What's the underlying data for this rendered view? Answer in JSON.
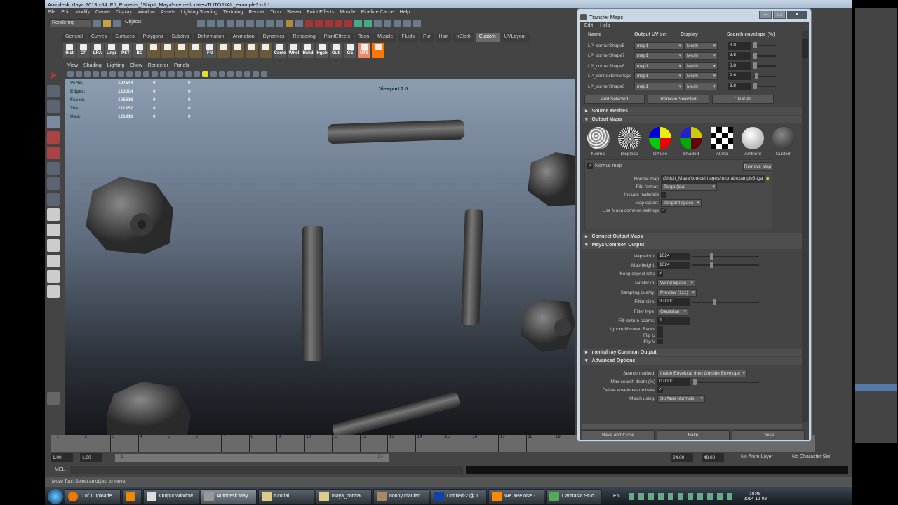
{
  "window": {
    "title": "Autodesk Maya 2013 x64: F:\\_Projects_\\ShipIt_Maya\\scenes\\crates\\TUTORIAL_example2.mb*"
  },
  "menu": [
    "File",
    "Edit",
    "Modify",
    "Create",
    "Display",
    "Window",
    "Assets",
    "Lighting/Shading",
    "Texturing",
    "Render",
    "Toon",
    "Stereo",
    "Paint Effects",
    "Muscle",
    "Pipeline Cache",
    "Help"
  ],
  "toolbar": {
    "menuset": "Rendering",
    "selection_mode": "Objects"
  },
  "shelf_tabs": [
    "General",
    "Curves",
    "Surfaces",
    "Polygons",
    "Subdivs",
    "Deformation",
    "Animation",
    "Dynamics",
    "Rendering",
    "PaintEffects",
    "Toon",
    "Muscle",
    "Fluids",
    "Fur",
    "Hair",
    "nCloth",
    "Custom",
    "UVLayout"
  ],
  "shelf_active": "Custom",
  "shelf_buttons": [
    "Hist",
    "CP",
    "LRA",
    "Ungr",
    "PST",
    "BC",
    "",
    "",
    "",
    "",
    "FN",
    "",
    "",
    "",
    "",
    "Cente",
    "Whol",
    "Hshd",
    "Hgph",
    "Outl",
    "GE",
    "UTE"
  ],
  "panel_menu": [
    "View",
    "Shading",
    "Lighting",
    "Show",
    "Renderer",
    "Panels"
  ],
  "hud": {
    "rows": [
      {
        "label": "Verts:",
        "v": [
          "107544",
          "0",
          "0"
        ]
      },
      {
        "label": "Edges:",
        "v": [
          "213004",
          "0",
          "0"
        ]
      },
      {
        "label": "Faces:",
        "v": [
          "105616",
          "0",
          "0"
        ]
      },
      {
        "label": "Tris:",
        "v": [
          "211352",
          "0",
          "0"
        ]
      },
      {
        "label": "UVs:",
        "v": [
          "121910",
          "0",
          "0"
        ]
      }
    ]
  },
  "viewport_name": "Viewport 2.0",
  "timeline": {
    "ticks": [
      "1",
      "2",
      "3",
      "4",
      "5",
      "6",
      "7",
      "8",
      "9",
      "10",
      "11",
      "12",
      "13",
      "14",
      "15",
      "16",
      "17",
      "18",
      "19"
    ]
  },
  "range": {
    "start": "1.00",
    "start2": "1.00",
    "slider_start": "1",
    "slider_end": "24",
    "end": "24.00",
    "end2": "48.00",
    "anim_layer": "No Anim Layer",
    "char_set": "No Character Set"
  },
  "mel": {
    "label": "MEL"
  },
  "helpline": "Move Tool: Select an object to move.",
  "dialog": {
    "title": "Transfer Maps",
    "menu": [
      "Edit",
      "Help"
    ],
    "columns": [
      "Name",
      "Output UV set",
      "Display",
      "Search envelope (%)"
    ],
    "meshes": [
      {
        "name": "LP_cornerShape5",
        "uv": "map1",
        "display": "Mesh",
        "env": "3.8"
      },
      {
        "name": "LP_cornerShape7",
        "uv": "map1",
        "display": "Mesh",
        "env": "3.8"
      },
      {
        "name": "LP_cornerShape8",
        "uv": "map1",
        "display": "Mesh",
        "env": "3.8"
      },
      {
        "name": "LP_connector8Shape",
        "uv": "map1",
        "display": "Mesh",
        "env": "9.6"
      },
      {
        "name": "LP_cornerShape6",
        "uv": "map1",
        "display": "Mesh",
        "env": "3.8"
      }
    ],
    "buttons": {
      "add": "Add Selected",
      "remove": "Remove Selected",
      "clear": "Clear All"
    },
    "sections": {
      "source": "Source Meshes",
      "output": "Output Maps",
      "connect": "Connect Output Maps",
      "common": "Maya Common Output",
      "mentalray": "mental ray Common Output",
      "advanced": "Advanced Options"
    },
    "maps": [
      "Normal",
      "Displace",
      "Diffuse",
      "Shaded",
      "Alpha",
      "Ambient",
      "Custom"
    ],
    "normal": {
      "label": "Normal map",
      "remove": "Remove Map",
      "path_label": "Normal map",
      "path": "/ShipIt_Maya/sourceimages/tutorial/example3.tga",
      "format_label": "File format:",
      "format": "Targa (tga)",
      "include_label": "Include materials",
      "space_label": "Map space:",
      "space": "Tangent space",
      "common_label": "Use Maya common settings"
    },
    "common": {
      "width_label": "Map width:",
      "width": "1024",
      "height_label": "Map height:",
      "height": "1024",
      "aspect_label": "Keep aspect ratio",
      "transfer_label": "Transfer in:",
      "transfer": "World Space",
      "quality_label": "Sampling quality:",
      "quality": "Preview (1x1)",
      "fsize_label": "Filter size:",
      "fsize": "3.0000",
      "ftype_label": "Filter type:",
      "ftype": "Gaussian",
      "seams_label": "Fill texture seams:",
      "seams": "1",
      "mirror_label": "Ignore Mirrored Faces",
      "flipu_label": "Flip U",
      "flipv_label": "Flip V"
    },
    "advanced": {
      "method_label": "Search method:",
      "method": "Inside Envelope then Outside Envelope",
      "depth_label": "Max search depth (%)",
      "depth": "0.0000",
      "delete_label": "Delete envelopes on bake",
      "match_label": "Match using:",
      "match": "Surface Normals"
    },
    "footer": {
      "bake_close": "Bake and Close",
      "bake": "Bake",
      "close": "Close"
    }
  },
  "taskbar": {
    "items": [
      "0 of 1 uploade...",
      "",
      "Output Window",
      "Autodesk May...",
      "tutorial",
      "maya_normal...",
      "nonny maulan...",
      "Untitled-2 @ 1...",
      "We aRe oNe - ...",
      "Camtasia Stud..."
    ],
    "lang": "EN",
    "time": "18:48",
    "date": "2014-12-03"
  }
}
